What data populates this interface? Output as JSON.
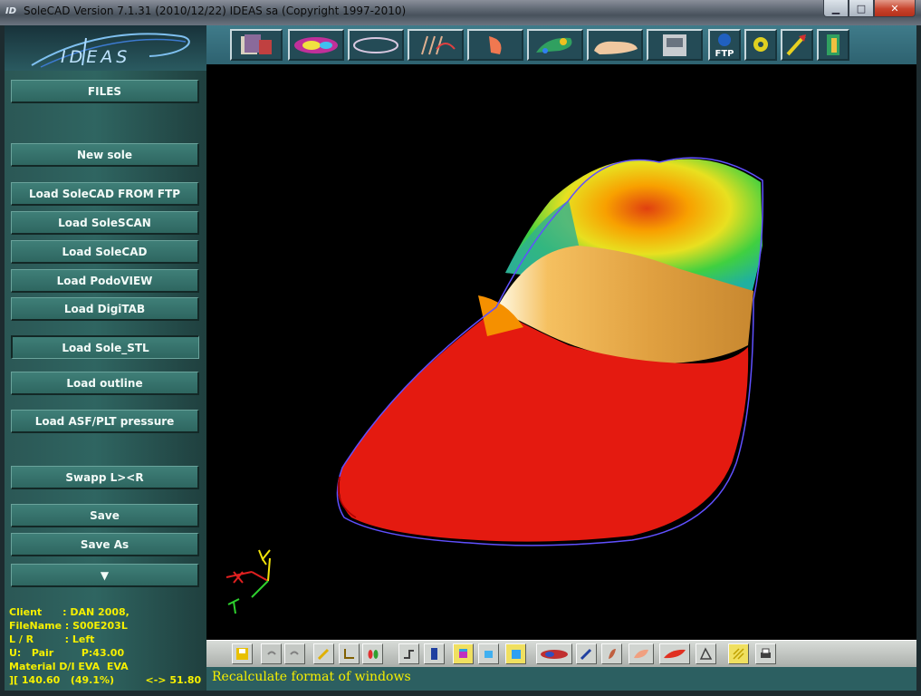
{
  "window": {
    "title": "SoleCAD Version 7.1.31 (2010/12/22)    IDEAS sa  (Copyright 1997-2010)",
    "app_icon": "ID",
    "minimize": "▁",
    "maximize": "□",
    "close": "✕"
  },
  "logo": {
    "text": "IDEAS"
  },
  "sidebar": {
    "files_label": "FILES",
    "new_sole": "New sole",
    "load_ftp": "Load SoleCAD FROM FTP",
    "load_solescan": "Load SoleSCAN",
    "load_solecad": "Load SoleCAD",
    "load_podoview": "Load PodoVIEW",
    "load_digitab": "Load DigiTAB",
    "load_sole_stl": "Load Sole_STL",
    "load_outline": "Load outline",
    "load_asf": "Load ASF/PLT pressure",
    "swapp": "Swapp L><R",
    "save": "Save",
    "save_as": "Save As",
    "more": "▼"
  },
  "info": {
    "client": "Client      : DAN 2008,",
    "filename": "FileName : S00E203L",
    "side": "L / R         : Left",
    "pair": "U:   Pair        P:43.00",
    "material": "Material D/I EVA  EVA",
    "dims": "][ 140.60   (49.1%)         <-> 51.80"
  },
  "toolbar_icons": [
    "file-stack-icon",
    "pressure-map-icon",
    "outline-icon",
    "scan-icon",
    "heel-icon",
    "sole-3d-icon",
    "foot-icon",
    "milling-machine-icon",
    "ftp-icon",
    "settings-icon",
    "edit-arrow-icon",
    "exit-door-icon"
  ],
  "toolbar": {
    "ftp_label": "FTP"
  },
  "bottom_icons": [
    "save-icon",
    "undo-icon",
    "redo-icon",
    "pencil-icon",
    "angle-icon",
    "footprint-icon",
    "profile-icon",
    "column-icon",
    "box-color-icon",
    "box-wire-icon",
    "box-solid-icon",
    "pressure-icon",
    "brush-icon",
    "sole-side-icon",
    "sole-top-icon",
    "sole-red-icon",
    "measure-icon",
    "grid-icon",
    "print-icon"
  ],
  "status": {
    "message": "Recalculate format of windows"
  },
  "axes": {
    "x_color": "#e02020",
    "y_color": "#f2e40a",
    "z_color": "#2ecf2e"
  }
}
